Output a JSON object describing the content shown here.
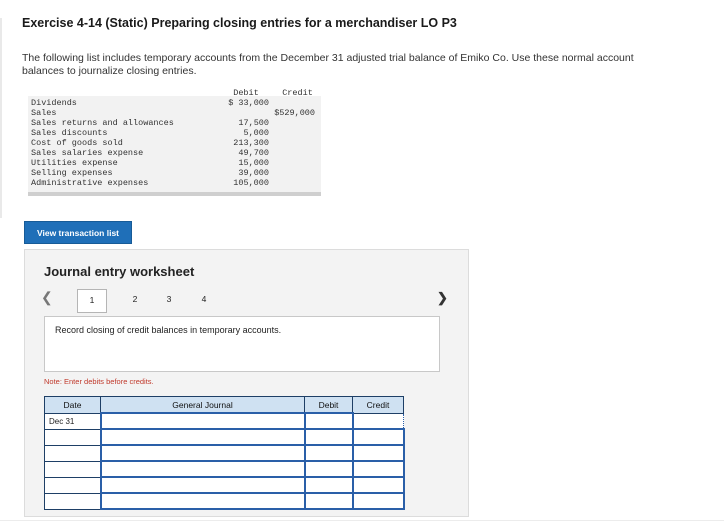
{
  "header": {
    "title": "Exercise 4-14 (Static) Preparing closing entries for a merchandiser LO P3",
    "intro": "The following list includes temporary accounts from the December 31 adjusted trial balance of Emiko Co. Use these normal account balances to journalize closing entries."
  },
  "trial_balance": {
    "debit_header": "Debit",
    "credit_header": "Credit",
    "rows": [
      {
        "account": "Dividends",
        "debit": "$ 33,000",
        "credit": ""
      },
      {
        "account": "Sales",
        "debit": "",
        "credit": "$529,000"
      },
      {
        "account": "Sales returns and allowances",
        "debit": "17,500",
        "credit": ""
      },
      {
        "account": "Sales discounts",
        "debit": "5,000",
        "credit": ""
      },
      {
        "account": "Cost of goods sold",
        "debit": "213,300",
        "credit": ""
      },
      {
        "account": "Sales salaries expense",
        "debit": "49,700",
        "credit": ""
      },
      {
        "account": "Utilities expense",
        "debit": "15,000",
        "credit": ""
      },
      {
        "account": "Selling expenses",
        "debit": "39,000",
        "credit": ""
      },
      {
        "account": "Administrative expenses",
        "debit": "105,000",
        "credit": ""
      }
    ]
  },
  "view_button": "View transaction list",
  "worksheet": {
    "title": "Journal entry worksheet",
    "steps": [
      "1",
      "2",
      "3",
      "4"
    ],
    "active_step": "1",
    "instruction": "Record closing of credit balances in temporary accounts.",
    "note": "Note: Enter debits before credits.",
    "table": {
      "headers": {
        "date": "Date",
        "journal": "General Journal",
        "debit": "Debit",
        "credit": "Credit"
      },
      "first_date": "Dec 31",
      "row_count": 6
    }
  }
}
